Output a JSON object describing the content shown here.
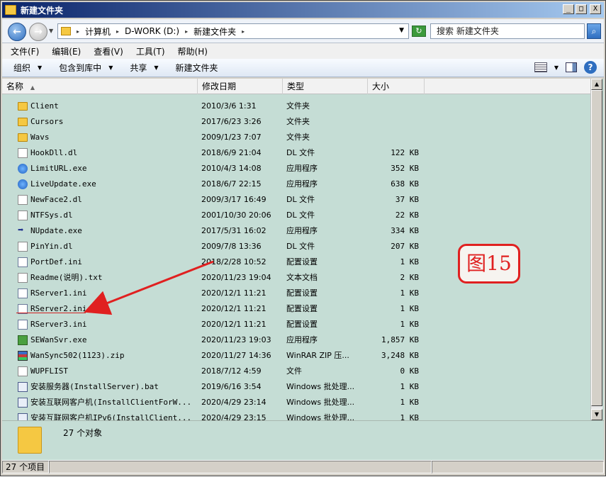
{
  "window": {
    "title": "新建文件夹"
  },
  "window_buttons": {
    "minimize": "_",
    "maximize": "□",
    "close": "X"
  },
  "address": {
    "crumbs": [
      "计算机",
      "D-WORK (D:)",
      "新建文件夹"
    ],
    "search_placeholder": "搜索 新建文件夹"
  },
  "menu": [
    {
      "label": "文件(F)"
    },
    {
      "label": "编辑(E)"
    },
    {
      "label": "查看(V)"
    },
    {
      "label": "工具(T)"
    },
    {
      "label": "帮助(H)"
    }
  ],
  "toolbar": {
    "organize": "组织",
    "include_in_library": "包含到库中",
    "share": "共享",
    "new_folder": "新建文件夹"
  },
  "columns": {
    "name": "名称",
    "date": "修改日期",
    "type": "类型",
    "size": "大小"
  },
  "files": [
    {
      "name": "Client",
      "date": "2010/3/6 1:31",
      "type": "文件夹",
      "size": "",
      "icon": "folder-icon"
    },
    {
      "name": "Cursors",
      "date": "2017/6/23 3:26",
      "type": "文件夹",
      "size": "",
      "icon": "folder-icon"
    },
    {
      "name": "Wavs",
      "date": "2009/1/23 7:07",
      "type": "文件夹",
      "size": "",
      "icon": "folder-icon"
    },
    {
      "name": "HookDll.dl",
      "date": "2018/6/9 21:04",
      "type": "DL 文件",
      "size": "122 KB",
      "icon": "file-icon"
    },
    {
      "name": "LimitURL.exe",
      "date": "2010/4/3 14:08",
      "type": "应用程序",
      "size": "352 KB",
      "icon": "globe-icon"
    },
    {
      "name": "LiveUpdate.exe",
      "date": "2018/6/7 22:15",
      "type": "应用程序",
      "size": "638 KB",
      "icon": "globe-icon"
    },
    {
      "name": "NewFace2.dl",
      "date": "2009/3/17 16:49",
      "type": "DL 文件",
      "size": "37 KB",
      "icon": "file-icon"
    },
    {
      "name": "NTFSys.dl",
      "date": "2001/10/30 20:06",
      "type": "DL 文件",
      "size": "22 KB",
      "icon": "file-icon"
    },
    {
      "name": "NUpdate.exe",
      "date": "2017/5/31 16:02",
      "type": "应用程序",
      "size": "334 KB",
      "icon": "arrow-icon"
    },
    {
      "name": "PinYin.dl",
      "date": "2009/7/8 13:36",
      "type": "DL 文件",
      "size": "207 KB",
      "icon": "file-icon"
    },
    {
      "name": "PortDef.ini",
      "date": "2018/2/28 10:52",
      "type": "配置设置",
      "size": "1 KB",
      "icon": "ini-icon"
    },
    {
      "name": "Readme(说明).txt",
      "date": "2020/11/23 19:04",
      "type": "文本文档",
      "size": "2 KB",
      "icon": "text-icon"
    },
    {
      "name": "RServer1.ini",
      "date": "2020/12/1 11:21",
      "type": "配置设置",
      "size": "1 KB",
      "icon": "ini-icon"
    },
    {
      "name": "RServer2.ini",
      "date": "2020/12/1 11:21",
      "type": "配置设置",
      "size": "1 KB",
      "icon": "ini-icon"
    },
    {
      "name": "RServer3.ini",
      "date": "2020/12/1 11:21",
      "type": "配置设置",
      "size": "1 KB",
      "icon": "ini-icon"
    },
    {
      "name": "SEWanSvr.exe",
      "date": "2020/11/23 19:03",
      "type": "应用程序",
      "size": "1,857 KB",
      "icon": "service-icon"
    },
    {
      "name": "WanSync502(1123).zip",
      "date": "2020/11/27 14:36",
      "type": "WinRAR ZIP 压...",
      "size": "3,248 KB",
      "icon": "zip-icon"
    },
    {
      "name": "WUPFLIST",
      "date": "2018/7/12 4:59",
      "type": "文件",
      "size": "0 KB",
      "icon": "file-icon"
    },
    {
      "name": "安装服务器(InstallServer).bat",
      "date": "2019/6/16 3:54",
      "type": "Windows 批处理...",
      "size": "1 KB",
      "icon": "batch-icon"
    },
    {
      "name": "安装互联网客户机(InstallClientForW...",
      "date": "2020/4/29 23:14",
      "type": "Windows 批处理...",
      "size": "1 KB",
      "icon": "batch-icon"
    },
    {
      "name": "安装互联网客户机IPv6(InstallClient...",
      "date": "2020/4/29 23:15",
      "type": "Windows 批处理...",
      "size": "1 KB",
      "icon": "batch-icon"
    }
  ],
  "annotation": {
    "label": "图15"
  },
  "details": {
    "count": "27 个对象"
  },
  "status": {
    "items": "27 个项目"
  },
  "colors": {
    "file_area_bg": "#c5ddd5",
    "annotation_red": "#e02020"
  }
}
